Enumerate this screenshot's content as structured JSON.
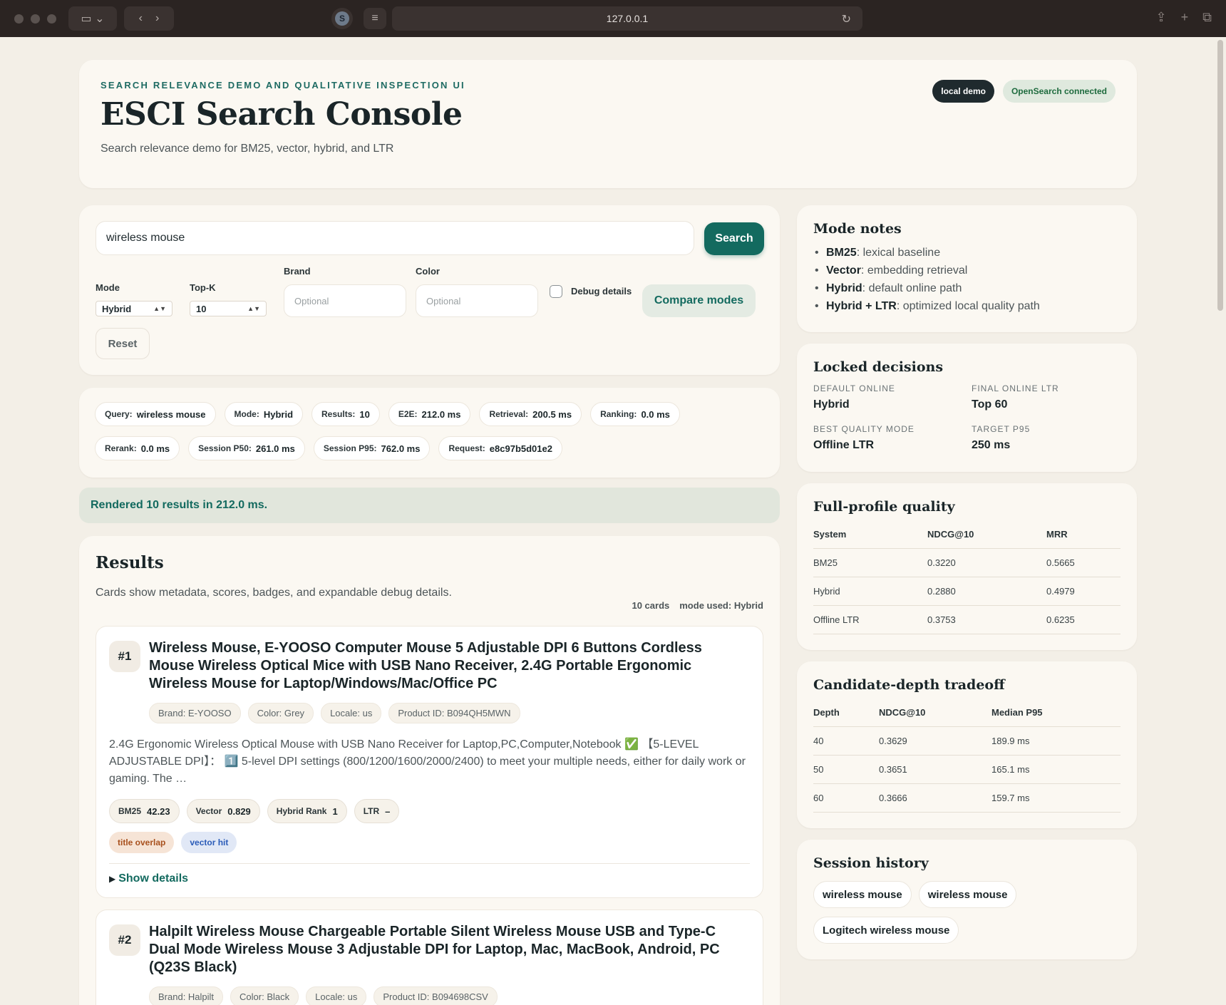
{
  "browser": {
    "url": "127.0.0.1"
  },
  "hero": {
    "eyebrow": "Search relevance demo and qualitative inspection UI",
    "title": "ESCI Search Console",
    "subtitle": "Search relevance demo for BM25, vector, hybrid, and LTR",
    "pill_local": "local demo",
    "pill_status": "OpenSearch connected"
  },
  "search": {
    "query": "wireless mouse",
    "search_label": "Search",
    "mode_label": "Mode",
    "mode_value": "Hybrid",
    "topk_label": "Top-K",
    "topk_value": "10",
    "brand_label": "Brand",
    "brand_placeholder": "Optional",
    "color_label": "Color",
    "color_placeholder": "Optional",
    "debug_label": "Debug details",
    "compare_label": "Compare modes",
    "reset_label": "Reset"
  },
  "metrics": [
    {
      "label": "Query:",
      "value": "wireless mouse"
    },
    {
      "label": "Mode:",
      "value": "Hybrid"
    },
    {
      "label": "Results:",
      "value": "10"
    },
    {
      "label": "E2E:",
      "value": "212.0 ms"
    },
    {
      "label": "Retrieval:",
      "value": "200.5 ms"
    },
    {
      "label": "Ranking:",
      "value": "0.0 ms"
    },
    {
      "label": "Rerank:",
      "value": "0.0 ms"
    },
    {
      "label": "Session P50:",
      "value": "261.0 ms"
    },
    {
      "label": "Session P95:",
      "value": "762.0 ms"
    },
    {
      "label": "Request:",
      "value": "e8c97b5d01e2"
    }
  ],
  "status": "Rendered 10 results in 212.0 ms.",
  "results": {
    "title": "Results",
    "subtitle": "Cards show metadata, scores, badges, and expandable debug details.",
    "count": "10 cards",
    "mode_used": "mode used: Hybrid",
    "items": [
      {
        "rank": "#1",
        "title": "Wireless Mouse, E-YOOSO Computer Mouse 5 Adjustable DPI 6 Buttons Cordless Mouse Wireless Optical Mice with USB Nano Receiver, 2.4G Portable Ergonomic Wireless Mouse for Laptop/Windows/Mac/Office PC",
        "brand": "Brand: E-YOOSO",
        "color": "Color: Grey",
        "locale": "Locale: us",
        "product_id": "Product ID: B094QH5MWN",
        "description": "2.4G Ergonomic Wireless Optical Mouse with USB Nano Receiver for Laptop,PC,Computer,Notebook ✅ 【5-LEVEL ADJUSTABLE DPI】： 1️⃣ 5-level DPI settings (800/1200/1600/2000/2400) to meet your multiple needs, either for daily work or gaming. The …",
        "bm25_label": "BM25",
        "bm25": "42.23",
        "vector_label": "Vector",
        "vector": "0.829",
        "hybrid_label": "Hybrid Rank",
        "hybrid": "1",
        "ltr_label": "LTR",
        "ltr": "–",
        "badge1": "title overlap",
        "badge2": "vector hit",
        "details": "Show details"
      },
      {
        "rank": "#2",
        "title": "Halpilt Wireless Mouse Chargeable Portable Silent Wireless Mouse USB and Type-C Dual Mode Wireless Mouse 3 Adjustable DPI for Laptop, Mac, MacBook, Android, PC (Q23S Black)",
        "brand": "Brand: Halpilt",
        "color": "Color: Black",
        "locale": "Locale: us",
        "product_id": "Product ID: B094698CSV"
      }
    ]
  },
  "mode_notes": {
    "title": "Mode notes",
    "items": [
      {
        "name": "BM25",
        "text": ": lexical baseline"
      },
      {
        "name": "Vector",
        "text": ": embedding retrieval"
      },
      {
        "name": "Hybrid",
        "text": ": default online path"
      },
      {
        "name": "Hybrid + LTR",
        "text": ": optimized local quality path"
      }
    ]
  },
  "decisions": {
    "title": "Locked decisions",
    "items": [
      {
        "label": "Default online",
        "value": "Hybrid"
      },
      {
        "label": "Final online LTR",
        "value": "Top 60"
      },
      {
        "label": "Best quality mode",
        "value": "Offline LTR"
      },
      {
        "label": "Target P95",
        "value": "250 ms"
      }
    ]
  },
  "quality": {
    "title": "Full-profile quality",
    "headers": [
      "System",
      "NDCG@10",
      "MRR"
    ],
    "rows": [
      [
        "BM25",
        "0.3220",
        "0.5665"
      ],
      [
        "Hybrid",
        "0.2880",
        "0.4979"
      ],
      [
        "Offline LTR",
        "0.3753",
        "0.6235"
      ]
    ]
  },
  "tradeoff": {
    "title": "Candidate-depth tradeoff",
    "headers": [
      "Depth",
      "NDCG@10",
      "Median P95"
    ],
    "rows": [
      [
        "40",
        "0.3629",
        "189.9 ms"
      ],
      [
        "50",
        "0.3651",
        "165.1 ms"
      ],
      [
        "60",
        "0.3666",
        "159.7 ms"
      ]
    ]
  },
  "history": {
    "title": "Session history",
    "items": [
      "wireless mouse",
      "wireless mouse",
      "Logitech wireless mouse"
    ]
  }
}
